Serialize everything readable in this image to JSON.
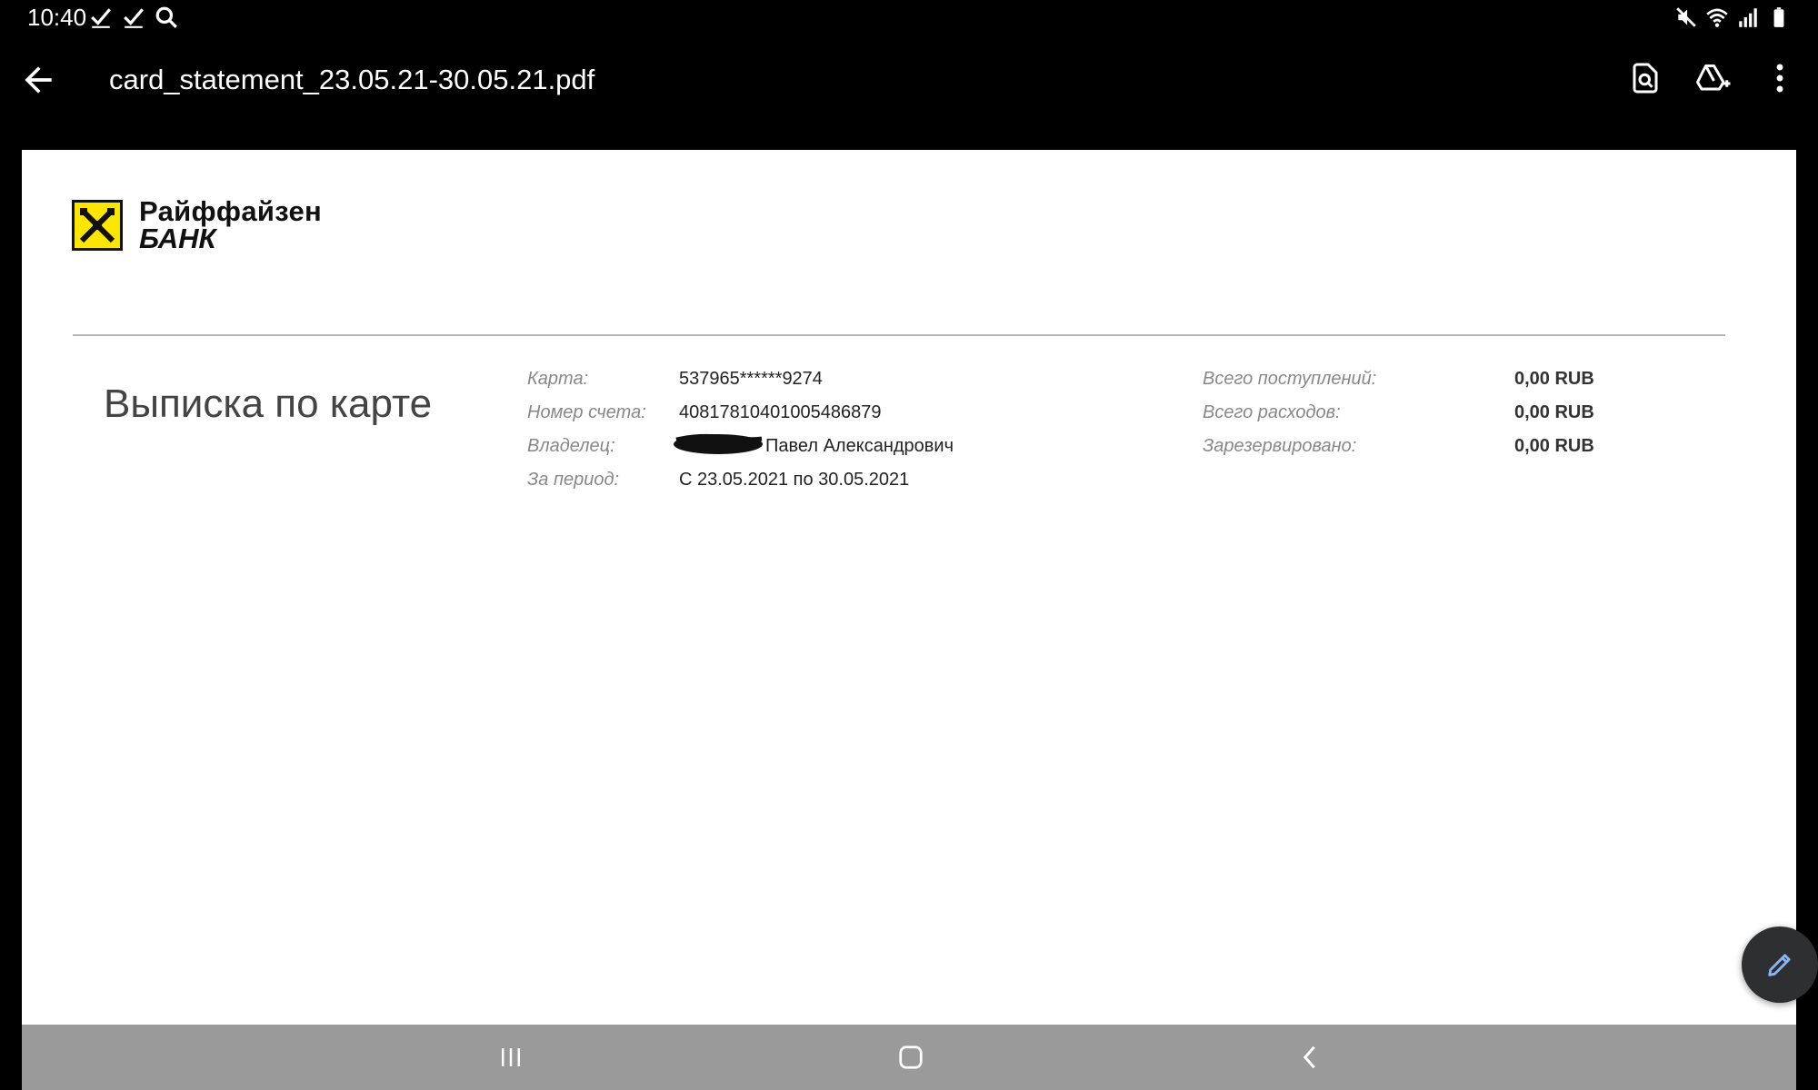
{
  "status_bar": {
    "time": "10:40",
    "left_icons": [
      "check-icon",
      "check-icon",
      "search-icon"
    ],
    "right_icons": [
      "mute-icon",
      "wifi-icon",
      "signal-icon",
      "battery-icon"
    ]
  },
  "app_bar": {
    "file_name": "card_statement_23.05.21-30.05.21.pdf",
    "actions": [
      "find-in-document-icon",
      "add-to-drive-icon",
      "more-options-icon"
    ]
  },
  "document": {
    "bank_logo": {
      "line1": "Райффайзен",
      "line2": "БАНК",
      "accent_color": "#fee600"
    },
    "title": "Выписка по карте",
    "fields": [
      {
        "label": "Карта:",
        "value": "537965******9274"
      },
      {
        "label": "Номер счета:",
        "value": "40817810401005486879"
      },
      {
        "label": "Владелец:",
        "value": "Павел Александрович"
      },
      {
        "label": "За период:",
        "value": "С 23.05.2021 по 30.05.2021"
      }
    ],
    "totals": [
      {
        "label": "Всего поступлений:",
        "value": "0,00 RUB"
      },
      {
        "label": "Всего расходов:",
        "value": "0,00 RUB"
      },
      {
        "label": "Зарезервировано:",
        "value": "0,00 RUB"
      }
    ]
  },
  "fab": {
    "icon": "edit-pencil-icon",
    "color": "#8ab4f8"
  },
  "nav_bar": {
    "buttons": [
      "recent-apps-icon",
      "home-icon",
      "back-icon"
    ]
  }
}
